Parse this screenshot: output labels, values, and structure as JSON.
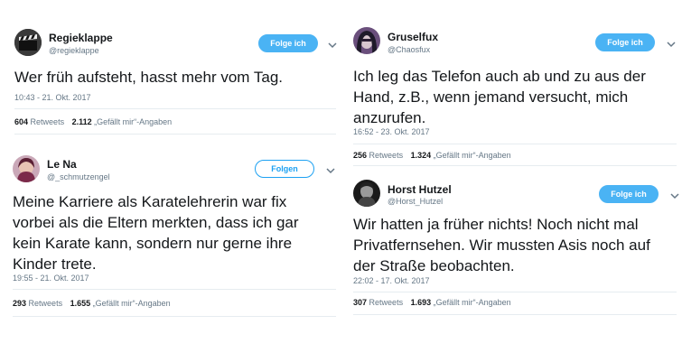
{
  "tweets": [
    {
      "name": "Regieklappe",
      "handle": "@regieklappe",
      "follow_label": "Folge ich",
      "text_lines": [
        "Wer früh aufsteht, hasst mehr vom Tag."
      ],
      "timestamp": "10:43 - 21. Okt. 2017",
      "retweets_count": "604",
      "retweets_label": "Retweets",
      "likes_count": "2.112",
      "likes_label": "„Gefällt mir“-Angaben"
    },
    {
      "name": "Le Na",
      "handle": "@_schmutzengel",
      "follow_label": "Folgen",
      "text_lines": [
        "Meine Karriere als Karatelehrerin war fix",
        "vorbei als die Eltern merkten, dass ich gar",
        "kein Karate kann, sondern nur gerne ihre",
        "Kinder trete."
      ],
      "timestamp": "19:55 - 21. Okt. 2017",
      "retweets_count": "293",
      "retweets_label": "Retweets",
      "likes_count": "1.655",
      "likes_label": "„Gefällt mir“-Angaben"
    },
    {
      "name": "Gruselfux",
      "handle": "@Chaosfux",
      "follow_label": "Folge ich",
      "text_lines": [
        "Ich leg das Telefon auch ab und zu aus der",
        "Hand, z.B., wenn jemand versucht, mich",
        "anzurufen."
      ],
      "timestamp": "16:52 - 23. Okt. 2017",
      "retweets_count": "256",
      "retweets_label": "Retweets",
      "likes_count": "1.324",
      "likes_label": "„Gefällt mir“-Angaben"
    },
    {
      "name": "Horst Hutzel",
      "handle": "@Horst_Hutzel",
      "follow_label": "Folge ich",
      "text_lines": [
        "Wir hatten ja früher nichts! Noch nicht mal",
        "Privatfernsehen. Wir mussten Asis noch auf",
        "der Straße beobachten."
      ],
      "timestamp": "22:02 - 17. Okt. 2017",
      "retweets_count": "307",
      "retweets_label": "Retweets",
      "likes_count": "1.693",
      "likes_label": "„Gefällt mir“-Angaben"
    }
  ],
  "colors": {
    "accent": "#1da1f2",
    "follow_fill": "#4ab3f4",
    "muted": "#657786",
    "divider": "#e6ecf0"
  },
  "icons": [
    "clapperboard-avatar",
    "user-avatar",
    "chevron-down-icon"
  ]
}
